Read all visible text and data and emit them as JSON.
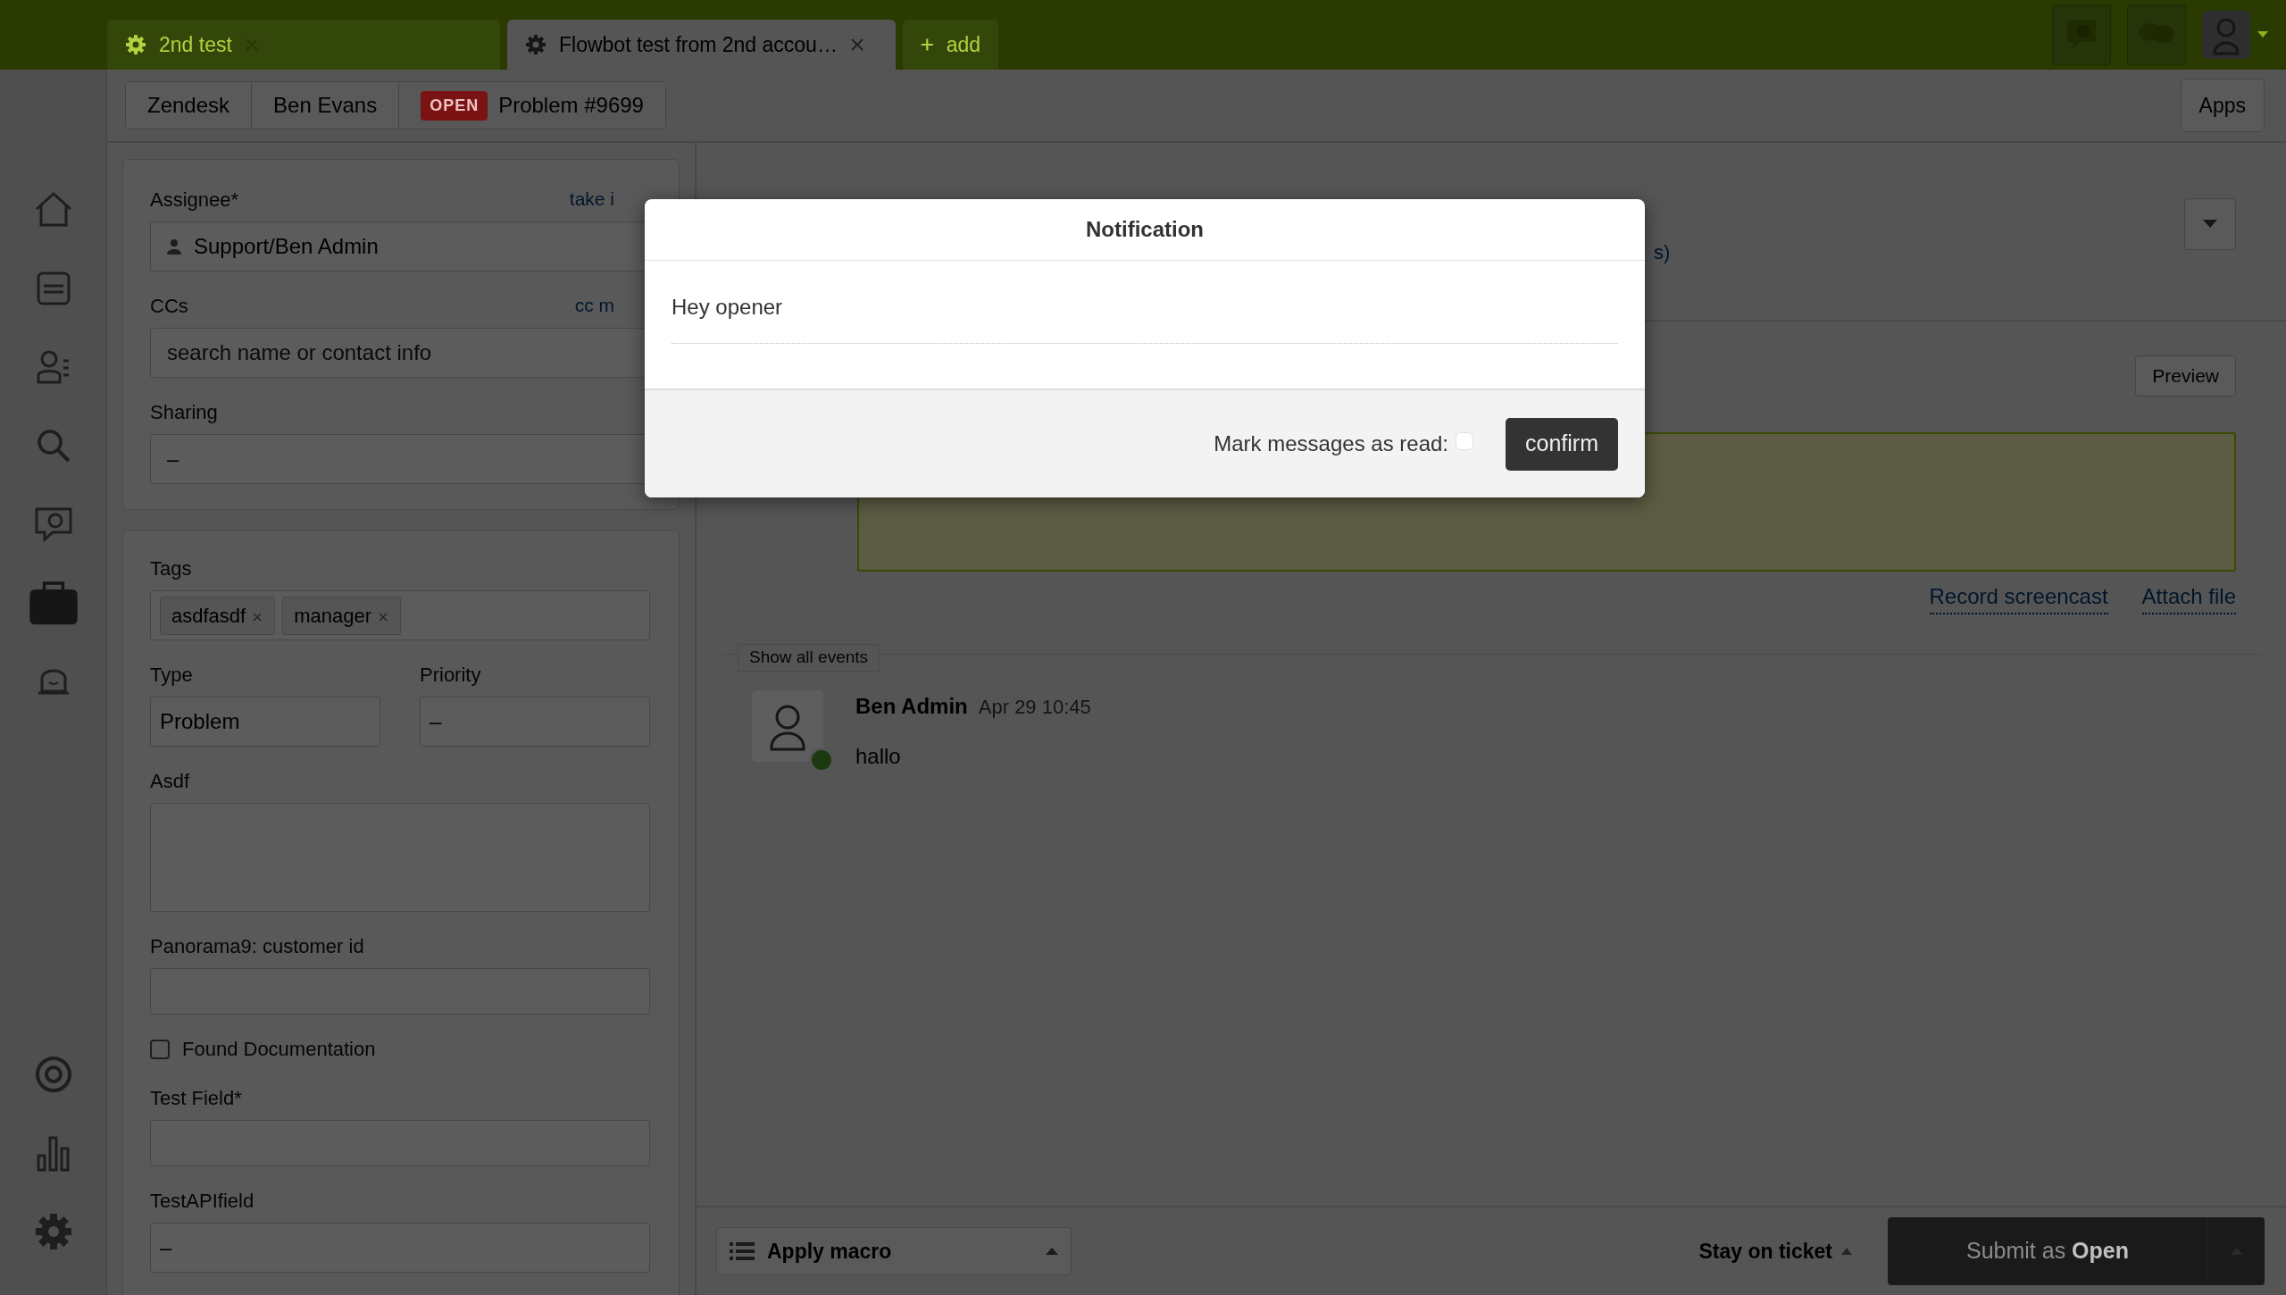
{
  "top_tabs": [
    {
      "title": "2nd test",
      "selected": false
    },
    {
      "title": "Flowbot test from 2nd accou…",
      "selected": true
    }
  ],
  "add_tab": "add",
  "sidebar": {
    "items": [
      {
        "selected": false
      },
      {
        "selected": false
      },
      {
        "selected": false
      },
      {
        "selected": false
      },
      {
        "selected": false
      },
      {
        "selected": true
      },
      {
        "selected": false
      },
      {
        "selected": false
      },
      {
        "selected": false
      },
      {
        "selected": false
      }
    ]
  },
  "breadcrumb": [
    {
      "label": "Zendesk"
    },
    {
      "label": "Ben Evans"
    },
    {
      "label": "Problem #9699",
      "badge": "OPEN"
    }
  ],
  "apps_button": "Apps",
  "ticket_fields": {
    "assignee": {
      "label": "Assignee*",
      "link": "take i",
      "value": "Support/Ben Admin"
    },
    "ccs": {
      "label": "CCs",
      "link": "cc m",
      "placeholder": "search name or contact info"
    },
    "sharing": {
      "label": "Sharing",
      "value": "–"
    },
    "tags": {
      "label": "Tags",
      "items": [
        "asdfasdf",
        "manager"
      ]
    },
    "type": {
      "label": "Type",
      "value": "Problem"
    },
    "priority": {
      "label": "Priority",
      "value": "–"
    },
    "asdf": {
      "label": "Asdf"
    },
    "panorama": {
      "label": "Panorama9: customer id"
    },
    "found_documentation": {
      "label": "Found Documentation",
      "checked": false
    },
    "test_field": {
      "label": "Test Field*"
    },
    "test_api_field": {
      "label": "TestAPIfield",
      "value": "–"
    }
  },
  "conversation": {
    "link_fragment": "s)",
    "preview_button": "Preview",
    "links": [
      "Record screencast",
      "Attach file"
    ],
    "show_all_events": "Show all events",
    "comment": {
      "author": "Ben Admin",
      "time": "Apr 29 10:45",
      "body": "hallo"
    }
  },
  "footer": {
    "apply_macro": "Apply macro",
    "stay_on_ticket": "Stay on ticket",
    "submit": "Submit as **Open**"
  },
  "modal": {
    "title": "Notification",
    "message": "Hey opener",
    "mark_read_label": "Mark messages as read:",
    "mark_read": false,
    "confirm": "confirm"
  }
}
